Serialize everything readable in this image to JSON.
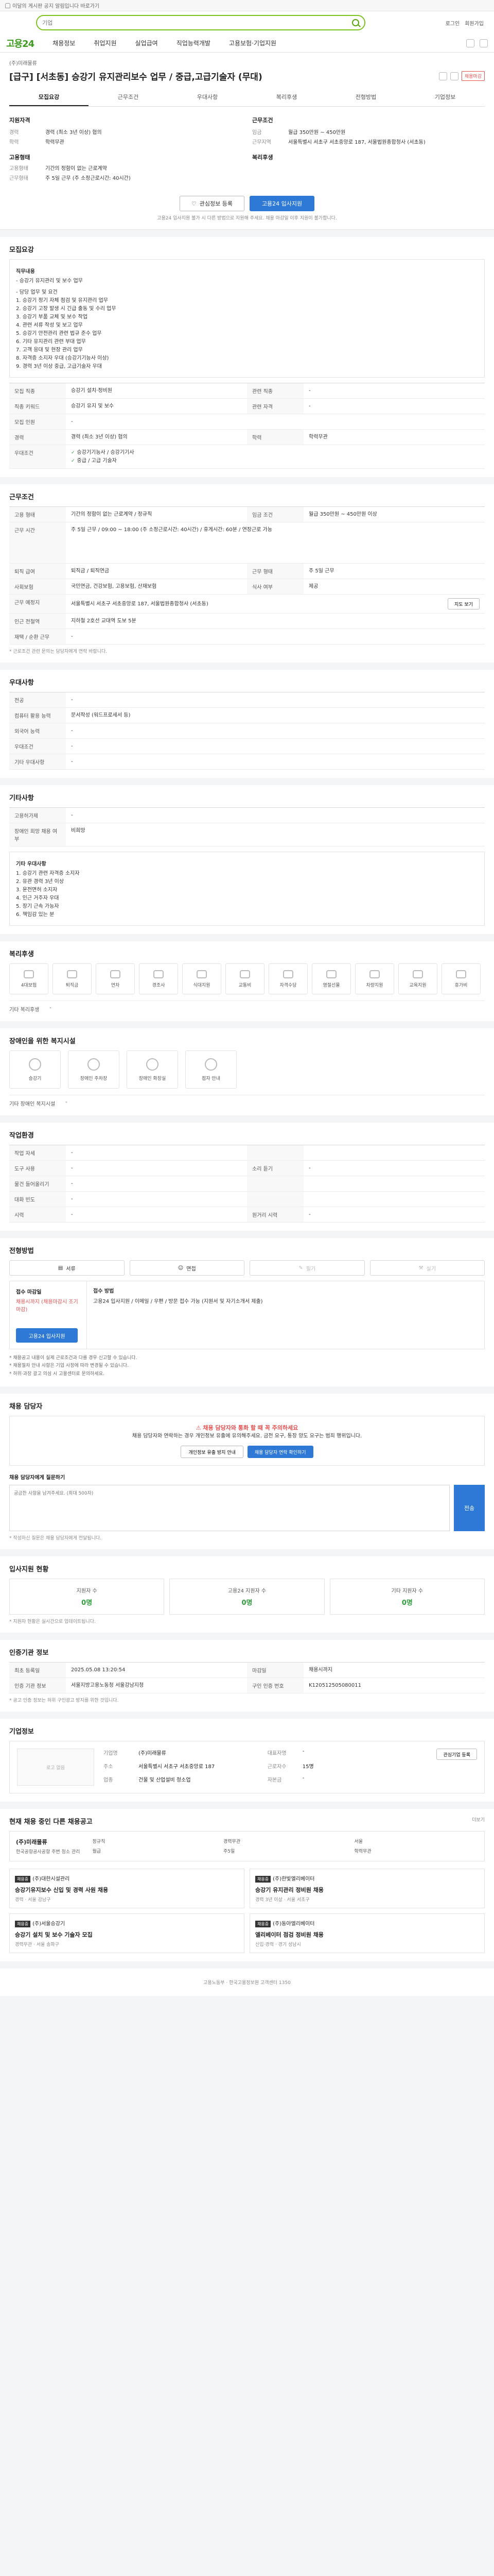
{
  "notice": {
    "text": "이달의 게시판 공지 알림입니다 바로가기"
  },
  "header": {
    "search_placeholder": "기업",
    "top_links": [
      "로그인",
      "회원가입"
    ],
    "logo": "고용24",
    "menu": [
      "채용정보",
      "취업지원",
      "실업급여",
      "직업능력개발",
      "고용보험·기업지원"
    ]
  },
  "job": {
    "company": "(주)미래물류",
    "title": "[급구] [서초동] 승강기 유지관리보수 업무 / 중급,고급기술자 (무대)",
    "badge": "채용마감",
    "tabs": [
      "모집요강",
      "근무조건",
      "우대사항",
      "복리후생",
      "전형방법",
      "기업정보"
    ],
    "summary": {
      "left_title": "지원자격",
      "left": [
        {
          "k": "경력",
          "v": "경력 (최소 3년 이상) 협의"
        },
        {
          "k": "학력",
          "v": "학력무관"
        }
      ],
      "left_sub": "고용형태",
      "left2": [
        {
          "k": "고용형태",
          "v": "기간의 정함이 없는 근로계약"
        },
        {
          "k": "근무형태",
          "v": "주 5일 근무 (주 소정근로시간: 40시간)"
        }
      ],
      "right_title": "근무조건",
      "right": [
        {
          "k": "임금",
          "v": "월급 350만원 ~ 450만원"
        },
        {
          "k": "근무지역",
          "v": "서울특별시 서초구 서초중앙로 187, 서울법원종합청사 (서초동)"
        }
      ],
      "right_sub": "복리후생"
    },
    "buttons": {
      "scrap": "관심정보 등록",
      "apply": "고용24 입사지원"
    },
    "summary_note": "고용24 입사지원 불가 시 다른 방법으로 지원해 주세요. 채용 마감일 이후 지원이 불가합니다."
  },
  "recruit": {
    "title": "모집요강",
    "desc_title": "직무내용",
    "desc_head": "- 승강기 유지관리 및 보수 업무",
    "desc_items": [
      "- 담당 업무 및 요건",
      "1. 승강기 정기 자체 점검 및 유지관리 업무",
      "2. 승강기 고장 발생 시 긴급 출동 및 수리 업무",
      "3. 승강기 부품 교체 및 보수 작업",
      "4. 관련 서류 작성 및 보고 업무",
      "5. 승강기 안전관리 관련 법규 준수 업무",
      "6. 기타 유지관리 관련 부대 업무",
      "7. 고객 응대 및 현장 관리 업무",
      "8. 자격증 소지자 우대 (승강기기능사 이상)",
      "9. 경력 3년 이상 중급, 고급기술자 우대"
    ],
    "rows": [
      {
        "k": "모집 직종",
        "v": "승강기 설치·정비원",
        "k2": "관련 직종",
        "v2": "-"
      },
      {
        "k": "직종 키워드",
        "v": "승강기 유지 및 보수",
        "k2": "관련 자격",
        "v2": "-"
      },
      {
        "k": "모집 인원",
        "v": "-",
        "k2": "",
        "v2": ""
      },
      {
        "k": "경력",
        "v": "경력 (최소 3년 이상) 협의",
        "k2": "학력",
        "v2": "학력무관"
      },
      {
        "k": "우대조건",
        "v": "승강기기능사 / 승강기기사",
        "k2": "",
        "v2": ""
      }
    ],
    "cert_note": "중급 / 고급 기술자"
  },
  "condition": {
    "title": "근무조건",
    "rows": [
      {
        "k": "고용 형태",
        "v": "기간의 정함이 없는 근로계약 / 정규직",
        "k2": "임금 조건",
        "v2": "월급 350만원 ~ 450만원 이상"
      },
      {
        "k": "근무 시간",
        "v": "주 5일 근무 / 09:00 ~ 18:00 (주 소정근로시간: 40시간) / 휴게시간: 60분 / 연장근로 가능"
      },
      {
        "k": "퇴직 급여",
        "v": "퇴직금 / 퇴직연금",
        "k2": "근무 형태",
        "v2": "주 5일 근무"
      },
      {
        "k": "사회보험",
        "v": "국민연금, 건강보험, 고용보험, 산재보험",
        "k2": "식사 여부",
        "v2": "제공"
      },
      {
        "k": "근무 예정지",
        "v": "서울특별시 서초구 서초중앙로 187, 서울법원종합청사 (서초동)"
      },
      {
        "k": "인근 전철역",
        "v": "지하철 2호선 교대역 도보 5분"
      },
      {
        "k": "재택 / 순환 근무",
        "v": "-"
      }
    ],
    "map_button": "지도 보기",
    "note": "* 근로조건 관련 문의는 담당자에게 연락 바랍니다."
  },
  "pref": {
    "title": "우대사항",
    "rows": [
      {
        "k": "전공",
        "v": "-"
      },
      {
        "k": "컴퓨터 활용 능력",
        "v": "문서작성 (워드프로세서 등)"
      },
      {
        "k": "외국어 능력",
        "v": "-"
      },
      {
        "k": "우대조건",
        "v": "-"
      },
      {
        "k": "기타 우대사항",
        "v": "-"
      }
    ]
  },
  "extra": {
    "title": "기타사항",
    "rows": [
      {
        "k": "고용허가제",
        "v": "-"
      },
      {
        "k": "장애인 희망 채용 여부",
        "v": "비희망"
      }
    ],
    "ex_title": "기타 우대사항",
    "ex_items": [
      "1. 승강기 관련 자격증 소지자",
      "2. 유관 경력 3년 이상",
      "3. 운전면허 소지자",
      "4. 인근 거주자 우대",
      "5. 장기 근속 가능자",
      "6. 책임감 있는 분"
    ]
  },
  "welfare": {
    "title": "복리후생",
    "items": [
      "4대보험",
      "퇴직금",
      "연차",
      "경조사",
      "식대지원",
      "교통비",
      "자격수당",
      "명절선물",
      "차량지원",
      "교육지원",
      "휴가비"
    ],
    "line_k": "기타 복리후생",
    "line_v": "-"
  },
  "disability": {
    "title": "장애인을 위한 복지시설",
    "items": [
      "승강기",
      "장애인 주차장",
      "장애인 화장실",
      "점자 안내"
    ],
    "line_k": "기타 장애인 복지시설",
    "line_v": "-"
  },
  "workplace": {
    "title": "작업환경",
    "rows": [
      {
        "k": "작업 자세",
        "v": "-",
        "k2": "",
        "v2": ""
      },
      {
        "k": "도구 사용",
        "v": "-",
        "k2": "소리 듣기",
        "v2": "-"
      },
      {
        "k": "물건 들어올리기",
        "v": "-",
        "k2": "",
        "v2": ""
      },
      {
        "k": "대화 빈도",
        "v": "-",
        "k2": "",
        "v2": ""
      },
      {
        "k": "시력",
        "v": "-",
        "k2": "원거리 시력",
        "v2": "-"
      }
    ]
  },
  "selection": {
    "title": "전형방법",
    "methods": [
      "서류",
      "면접",
      "필기",
      "실기"
    ],
    "deadline_k": "접수 마감일",
    "deadline_v": "채용시까지 (채용마감시 조기마감)",
    "process_k": "접수 방법",
    "process_v": "고용24 입사지원 / 이메일 / 우편 / 방문 접수 가능 (지원서 및 자기소개서 제출)",
    "apply_button": "고용24 입사지원",
    "bullets": [
      "* 채용공고 내용이 실제 근로조건과 다를 경우 신고할 수 있습니다.",
      "* 채용절차 안내 사항은 기업 사정에 따라 변경될 수 있습니다.",
      "* 허위·과장 광고 의심 시 고용센터로 문의하세요."
    ]
  },
  "contact": {
    "title": "채용 담당자",
    "warn_title": "채용 담당자와 통화 할 때 꼭 주의하세요",
    "warn_text": "채용 담당자와 연락하는 경우 개인정보 유출에 유의해주세요. 금전 요구, 통장 양도 요구는 범죄 행위입니다.",
    "btn1": "개인정보 유출 방지 안내",
    "btn2": "채용 담당자 연락 확인하기",
    "ask_label": "채용 담당자에게 질문하기",
    "ask_placeholder": "궁금한 사항을 남겨주세요. (최대 500자)",
    "ask_button": "전송",
    "ask_note": "* 작성하신 질문은 채용 담당자에게 전달됩니다."
  },
  "stats": {
    "title": "입사지원 현황",
    "items": [
      {
        "k": "지원자 수",
        "v": "0명"
      },
      {
        "k": "고용24 지원자 수",
        "v": "0명"
      },
      {
        "k": "기타 지원자 수",
        "v": "0명"
      }
    ],
    "note": "* 지원자 현황은 실시간으로 업데이트됩니다."
  },
  "info": {
    "title": "인증기관 정보",
    "rows": [
      {
        "k": "최초 등록일",
        "v": "2025.05.08 13:20:54",
        "k2": "마감일",
        "v2": "채용시까지"
      },
      {
        "k": "인증 기관 정보",
        "v": "서울지방고용노동청 서울강남지청",
        "k2": "구인 인증 번호",
        "v2": "K120512505080011"
      }
    ],
    "note": "* 공고 인증 정보는 허위 구인광고 방지를 위한 것입니다."
  },
  "company": {
    "title": "기업정보",
    "logo_text": "로고 없음",
    "name_k": "기업명",
    "name_v": "(주)미래물류",
    "ceo_k": "대표자명",
    "ceo_v": "-",
    "addr_k": "주소",
    "addr_v": "서울특별시 서초구 서초중앙로 187",
    "emp_k": "근로자수",
    "emp_v": "15명",
    "ind_k": "업종",
    "ind_v": "건물 및 산업설비 청소업",
    "cap_k": "자본금",
    "cap_v": "-",
    "fav_button": "관심기업 등록"
  },
  "other": {
    "title": "현재 채용 중인 다른 채용공고",
    "more": "더보기",
    "side": {
      "name": "(주)미래물류",
      "sub": "한국공항공사공항 주변 청소 관리",
      "items": [
        "정규직",
        "경력무관",
        "서울",
        "월급",
        "주5일",
        "학력무관"
      ]
    },
    "cards": [
      {
        "tag": "채용중",
        "company": "(주)대한시설관리",
        "title": "승강기유지보수 신입 및 경력 사원 채용",
        "meta": "경력 · 서울 강남구"
      },
      {
        "tag": "채용중",
        "company": "(주)한빛엘리베이터",
        "title": "승강기 유지관리 정비원 채용",
        "meta": "경력 3년 이상 · 서울 서초구"
      },
      {
        "tag": "채용중",
        "company": "(주)서울승강기",
        "title": "승강기 설치 및 보수 기술자 모집",
        "meta": "경력무관 · 서울 송파구"
      },
      {
        "tag": "채용중",
        "company": "(주)동아엘리베이터",
        "title": "엘리베이터 점검 정비원 채용",
        "meta": "신입·경력 · 경기 성남시"
      }
    ]
  },
  "footer": {
    "text": "고용노동부 · 한국고용정보원 고객센터 1350"
  }
}
